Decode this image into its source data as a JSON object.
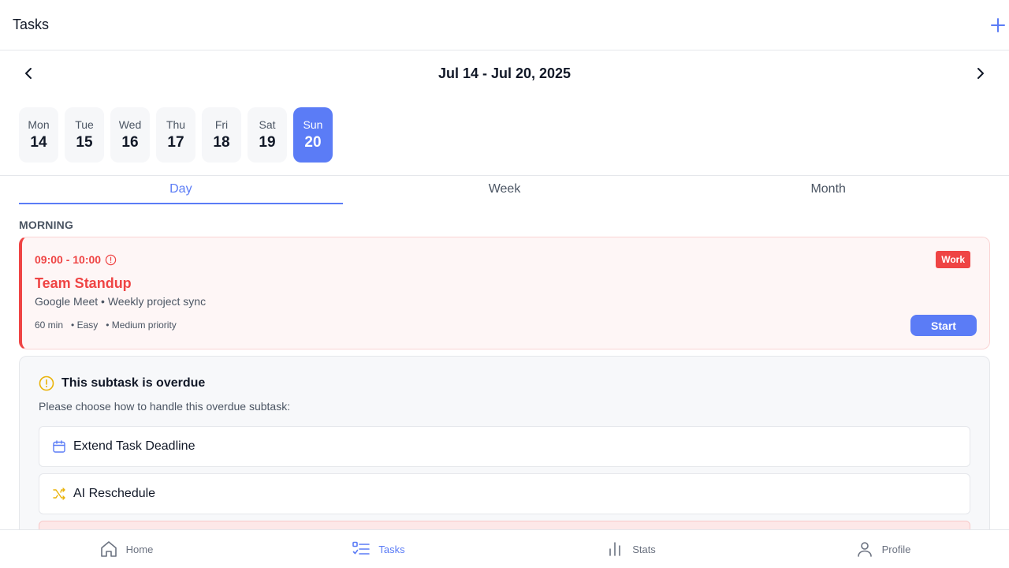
{
  "header": {
    "title": "Tasks",
    "add_icon": "plus-icon"
  },
  "week_nav": {
    "range": "Jul 14 - Jul 20, 2025"
  },
  "days": [
    {
      "name": "Mon",
      "num": "14"
    },
    {
      "name": "Tue",
      "num": "15"
    },
    {
      "name": "Wed",
      "num": "16"
    },
    {
      "name": "Thu",
      "num": "17"
    },
    {
      "name": "Fri",
      "num": "18"
    },
    {
      "name": "Sat",
      "num": "19"
    },
    {
      "name": "Sun",
      "num": "20"
    }
  ],
  "selected_day": "Sun",
  "tabs": [
    {
      "label": "Day"
    },
    {
      "label": "Week"
    },
    {
      "label": "Month"
    }
  ],
  "active_tab": "Day",
  "section": {
    "label": "MORNING"
  },
  "task": {
    "time": "09:00 - 10:00",
    "title": "Team Standup",
    "description": "Google Meet • Weekly project sync",
    "duration": "60 min",
    "difficulty": "• Easy",
    "priority": "• Medium priority",
    "badge": "Work",
    "start_label": "Start"
  },
  "overdue": {
    "title": "This subtask is overdue",
    "subtitle": "Please choose how to handle this overdue subtask:",
    "options": [
      {
        "label": "Extend Task Deadline",
        "icon": "calendar-icon"
      },
      {
        "label": "AI Reschedule",
        "icon": "shuffle-icon"
      }
    ]
  },
  "bottom_nav": [
    {
      "label": "Home",
      "icon": "home-icon"
    },
    {
      "label": "Tasks",
      "icon": "tasks-icon"
    },
    {
      "label": "Stats",
      "icon": "stats-icon"
    },
    {
      "label": "Profile",
      "icon": "profile-icon"
    }
  ],
  "colors": {
    "accent": "#5b7cf6",
    "danger": "#ef4444",
    "warning": "#eab308"
  }
}
